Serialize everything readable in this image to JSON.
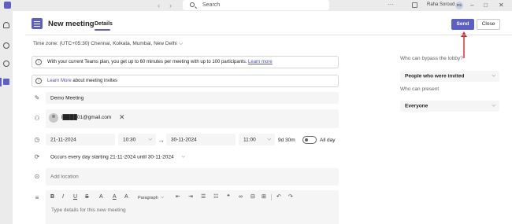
{
  "topbar": {
    "search_placeholder": "Search",
    "more_label": "···",
    "user_name": "Raha Soroud",
    "avatar_initials": "RS",
    "minimize": "–",
    "maximize": "□",
    "close": "✕",
    "back": "‹",
    "forward": "›"
  },
  "header": {
    "title": "New meeting",
    "tab_details": "Details",
    "send_label": "Send",
    "close_label": "Close",
    "accent_color": "#5b5fc7",
    "annotation_color": "#e02020"
  },
  "timezone": {
    "label": "Time zone: (UTC+05:30) Chennai, Kolkata, Mumbai, New Delhi",
    "chevron": "⌵"
  },
  "info": {
    "plan_text": "With your current Teams plan, you get up to 60 minutes per meeting with up to 100 participants. ",
    "plan_link": "Learn more",
    "invite_link": "Learn More",
    "invite_text": " about meeting invites"
  },
  "form": {
    "title_value": "Demo Meeting",
    "attendee_email": "l████01@gmail.com",
    "attendee_remove": "✕",
    "start_date": "21-11-2024",
    "start_time": "10:30",
    "arrow": "→",
    "end_date": "30-11-2024",
    "end_time": "11:00",
    "duration": "9d 30m",
    "all_day_label": "All day",
    "all_day_on": false,
    "recurrence": "Occurs every day starting 21-11-2024 until 30-11-2024",
    "location_placeholder": "Add location",
    "details_placeholder": "Type details for this new meeting"
  },
  "toolbar": {
    "bold": "B",
    "italic": "I",
    "underline": "U",
    "strike": "S",
    "font_size": "A",
    "font_color": "A",
    "highlight": "A",
    "paragraph": "Paragraph",
    "paragraph_chev": "⌵",
    "outdent": "⇤",
    "indent": "⇥",
    "bullets": "☰",
    "numbers": "☷",
    "quote": "❝",
    "link": "∞",
    "code": "⊟",
    "table": "⊞",
    "undo": "↶",
    "redo": "↷"
  },
  "lobby": {
    "bypass_label": "Who can bypass the lobby?",
    "bypass_value": "People who were invited",
    "present_label": "Who can present",
    "present_value": "Everyone"
  },
  "icons": {
    "info": "i",
    "pencil": "✎",
    "people": "⚇",
    "clock": "◷",
    "recur": "⟳",
    "location": "⊙",
    "details": "≡"
  }
}
